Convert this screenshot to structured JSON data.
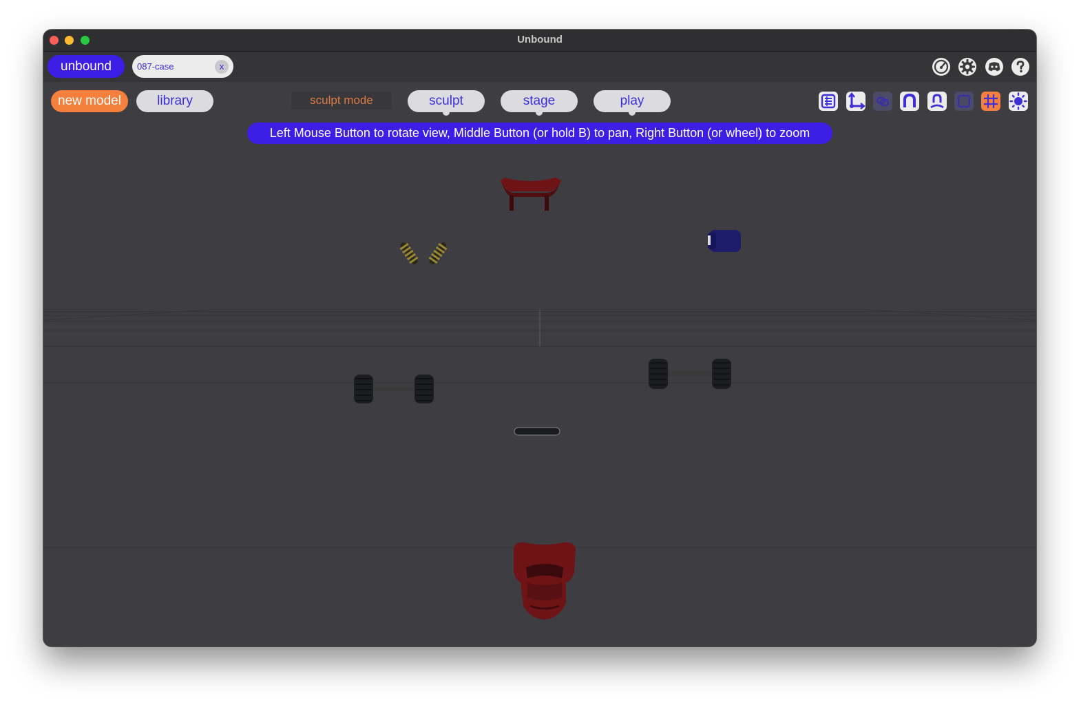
{
  "window": {
    "title": "Unbound"
  },
  "topbar": {
    "brand": "unbound",
    "file_tab": {
      "name": "087-case",
      "close": "x"
    },
    "icons": [
      "performance-gauge-icon",
      "settings-gear-icon",
      "discord-icon",
      "help-icon"
    ]
  },
  "toolbar": {
    "new_model": "new model",
    "library": "library",
    "mode_label": "sculpt mode",
    "tabs": [
      {
        "label": "sculpt"
      },
      {
        "label": "stage"
      },
      {
        "label": "play"
      }
    ],
    "tools": [
      "list-panel-icon",
      "axes-icon",
      "link-icon",
      "magnet-icon",
      "mirror-icon",
      "frame-icon",
      "grid-icon",
      "light-icon"
    ]
  },
  "hint": "Left Mouse Button to rotate view, Middle Button (or hold B) to pan, Right Button (or wheel) to zoom",
  "colors": {
    "accent_purple": "#3d1ee6",
    "accent_orange": "#f5803e",
    "viewport_bg": "#3d3d42",
    "part_red": "#6e1416",
    "part_blue": "#1d1d6b",
    "part_yellow": "#8a7a2a",
    "part_dark": "#1e1f22"
  }
}
